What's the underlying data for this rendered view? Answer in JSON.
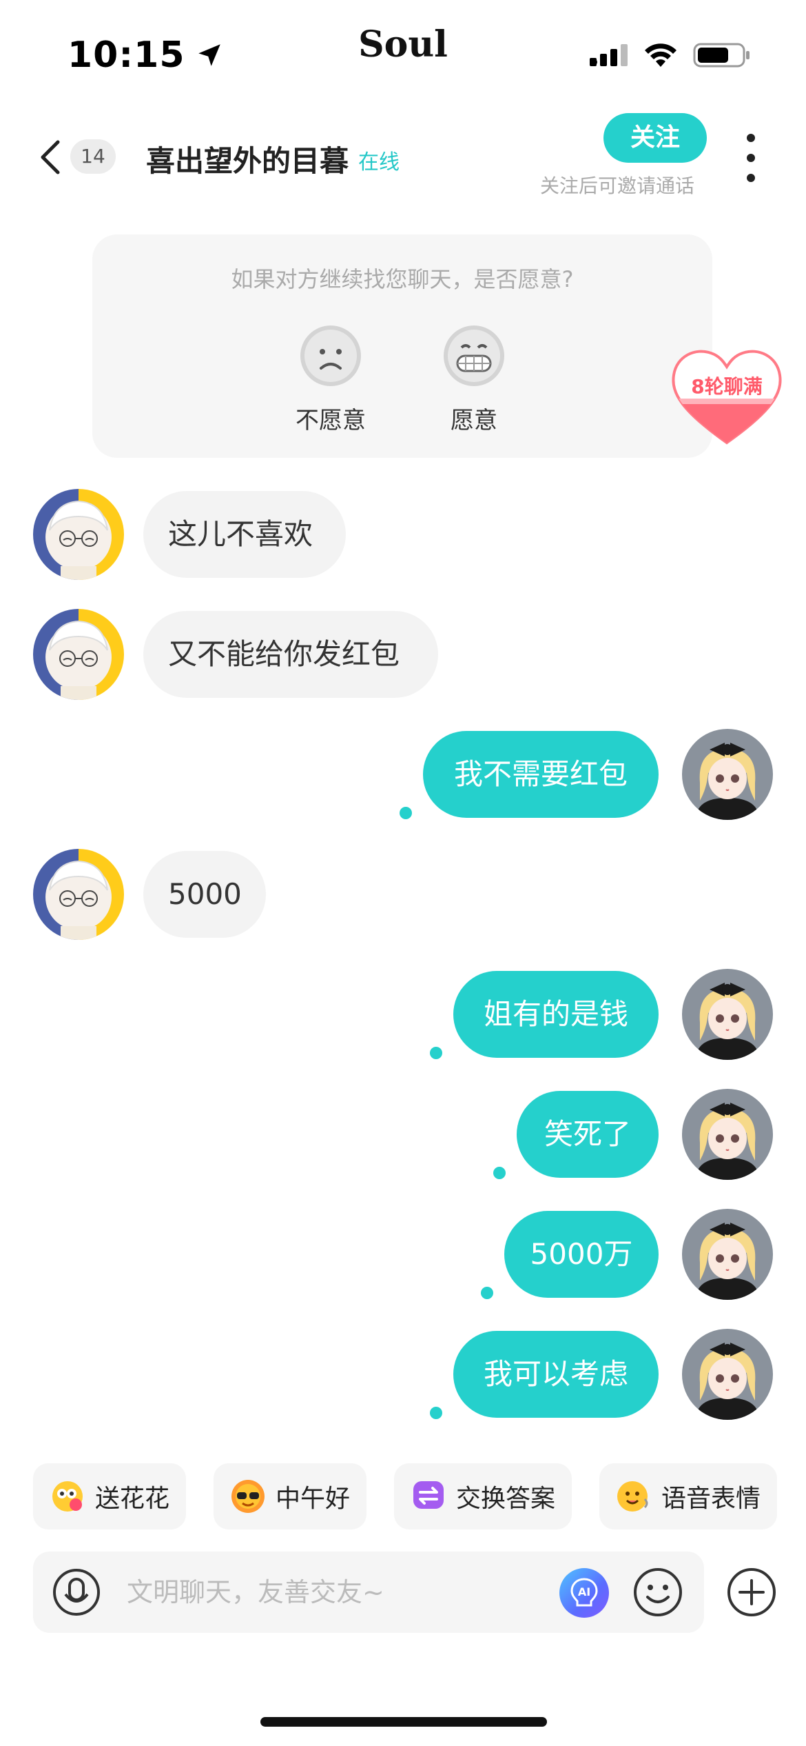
{
  "status_bar": {
    "time": "10:15",
    "brand": "Soul"
  },
  "header": {
    "count_badge": "14",
    "peer_name": "喜出望外的目暮",
    "online_status": "在线",
    "follow_label": "关注",
    "follow_hint": "关注后可邀请通话"
  },
  "survey": {
    "question": "如果对方继续找您聊天，是否愿意?",
    "options": [
      "不愿意",
      "愿意"
    ],
    "heart_badge": "8轮聊满"
  },
  "messages": [
    {
      "side": "in",
      "text": "这儿不喜欢"
    },
    {
      "side": "in",
      "text": "又不能给你发红包"
    },
    {
      "side": "out",
      "text": "我不需要红包"
    },
    {
      "side": "in",
      "text": "5000"
    },
    {
      "side": "out",
      "text": "姐有的是钱"
    },
    {
      "side": "out",
      "text": "笑死了"
    },
    {
      "side": "out",
      "text": "5000万"
    },
    {
      "side": "out",
      "text": "我可以考虑"
    }
  ],
  "chips": [
    {
      "label": "送花花",
      "icon": "flower-emoji-icon"
    },
    {
      "label": "中午好",
      "icon": "sun-sunglasses-icon"
    },
    {
      "label": "交换答案",
      "icon": "exchange-icon"
    },
    {
      "label": "语音表情",
      "icon": "voice-emoji-icon"
    }
  ],
  "input": {
    "placeholder": "文明聊天，友善交友~"
  },
  "colors": {
    "accent": "#25d0cc",
    "bubble_in": "#f3f3f3",
    "heart": "#ff6b7a"
  }
}
